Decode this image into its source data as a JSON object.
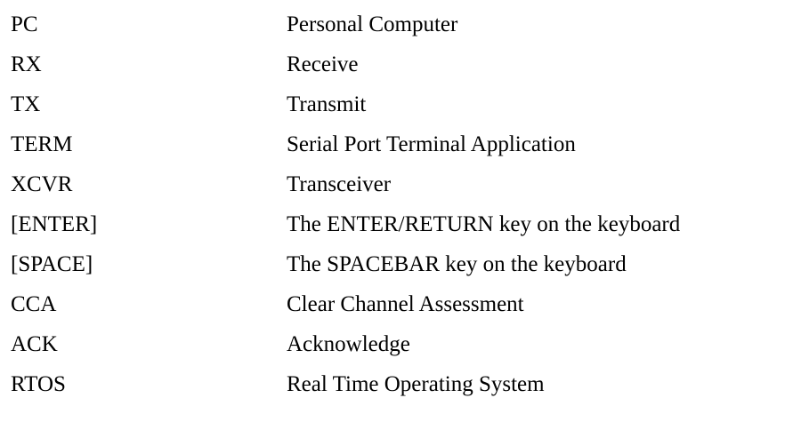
{
  "glossary": [
    {
      "term": "PC",
      "definition": "Personal Computer"
    },
    {
      "term": "RX",
      "definition": "Receive"
    },
    {
      "term": "TX",
      "definition": "Transmit"
    },
    {
      "term": "TERM",
      "definition": "Serial Port Terminal Application"
    },
    {
      "term": "XCVR",
      "definition": "Transceiver"
    },
    {
      "term": "[ENTER]",
      "definition": "The ENTER/RETURN key on the keyboard"
    },
    {
      "term": "[SPACE]",
      "definition": "The SPACEBAR key on the keyboard"
    },
    {
      "term": "CCA",
      "definition": "Clear Channel Assessment"
    },
    {
      "term": "ACK",
      "definition": "Acknowledge"
    },
    {
      "term": "RTOS",
      "definition": "Real Time Operating System"
    }
  ]
}
